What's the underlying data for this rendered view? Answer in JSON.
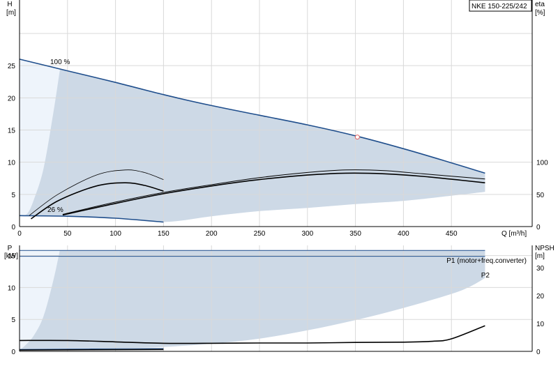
{
  "chart_data": [
    {
      "type": "line",
      "title": "NKE 150-225/242",
      "x_unit_label": "Q [m³/h]",
      "x_range": [
        0,
        500
      ],
      "x_ticks": [
        0,
        50,
        100,
        150,
        200,
        250,
        300,
        350,
        400,
        450
      ],
      "y_left": {
        "label_top": "H",
        "label_unit": "[m]",
        "range": [
          0,
          30
        ],
        "ticks": [
          0,
          5,
          10,
          15,
          20,
          25
        ]
      },
      "y_right": {
        "label_top": "eta",
        "label_unit": "[%]",
        "range": [
          0,
          100
        ],
        "ticks": [
          0,
          50,
          100
        ]
      },
      "grid": true,
      "annotations": [
        "100 %",
        "26 %"
      ],
      "operating_point": {
        "q": 352,
        "h": 13.9
      },
      "series": [
        {
          "role": "head_max",
          "axis": "left",
          "color": "#1f4e8c",
          "x": [
            0,
            50,
            100,
            150,
            200,
            250,
            300,
            350,
            400,
            450,
            485
          ],
          "y": [
            26.0,
            24.2,
            22.4,
            20.5,
            18.8,
            17.3,
            15.8,
            14.1,
            12.1,
            9.9,
            8.3
          ]
        },
        {
          "role": "head_min",
          "axis": "left",
          "color": "#1f4e8c",
          "x": [
            0,
            50,
            100,
            150
          ],
          "y": [
            1.7,
            1.6,
            1.3,
            0.7
          ]
        },
        {
          "role": "eta_p1",
          "axis": "left",
          "color": "#000000",
          "x": [
            45,
            100,
            150,
            200,
            250,
            300,
            340,
            380,
            420,
            460,
            485
          ],
          "y": [
            1.9,
            3.8,
            5.3,
            6.5,
            7.6,
            8.4,
            8.8,
            8.7,
            8.2,
            7.7,
            7.4
          ]
        },
        {
          "role": "eta_p2",
          "axis": "left",
          "color": "#000000",
          "x": [
            45,
            100,
            150,
            200,
            250,
            300,
            340,
            380,
            420,
            460,
            485
          ],
          "y": [
            1.8,
            3.6,
            5.1,
            6.3,
            7.3,
            8.0,
            8.3,
            8.2,
            7.8,
            7.2,
            6.8
          ]
        },
        {
          "role": "eta_low_thin",
          "axis": "left",
          "color": "#000000",
          "x": [
            10,
            40,
            80,
            110,
            130,
            150
          ],
          "y": [
            1.7,
            5.0,
            8.0,
            8.8,
            8.4,
            7.3
          ]
        },
        {
          "role": "eta_low_thick",
          "axis": "left",
          "color": "#000000",
          "x": [
            12,
            40,
            80,
            110,
            130,
            150
          ],
          "y": [
            1.2,
            4.0,
            6.3,
            6.8,
            6.4,
            5.5
          ]
        }
      ],
      "region_outer": {
        "upper_x": [
          0,
          50,
          100,
          150,
          200,
          250,
          300,
          350,
          400,
          450,
          485
        ],
        "upper_y": [
          26.0,
          24.2,
          22.4,
          20.5,
          18.8,
          17.3,
          15.8,
          14.1,
          12.1,
          9.9,
          8.3
        ],
        "lower_x": [
          485,
          450,
          400,
          350,
          300,
          250,
          200,
          150,
          100,
          50,
          0
        ],
        "lower_y": [
          5.4,
          4.8,
          4.0,
          3.5,
          2.9,
          2.4,
          1.6,
          0.7,
          1.3,
          1.6,
          1.7
        ]
      },
      "region_inner_lower": {
        "x": [
          42,
          35,
          25,
          15,
          8,
          0
        ],
        "y": [
          24.3,
          17.5,
          9.0,
          4.2,
          2.0,
          1.7
        ]
      }
    },
    {
      "type": "line",
      "x_range": [
        0,
        500
      ],
      "x_ticks": [
        50,
        100,
        150,
        200,
        250,
        300,
        350,
        400,
        450
      ],
      "y_left": {
        "label_top": "P",
        "label_unit": "[kW]",
        "range": [
          0,
          17.5
        ],
        "ticks": [
          0,
          5,
          10,
          15
        ]
      },
      "y_right": {
        "label_top": "NPSH",
        "label_unit": "[m]",
        "range": [
          0,
          35
        ],
        "ticks": [
          0,
          10,
          20,
          30
        ]
      },
      "grid": true,
      "legend": [
        "P1 (motor+freq.converter)",
        "P2"
      ],
      "series": [
        {
          "name": "P1 (motor+freq.converter)",
          "axis": "left",
          "color": "#1f4e8c",
          "x": [
            0,
            485
          ],
          "y": [
            15.8,
            15.8
          ]
        },
        {
          "name": "P2",
          "axis": "left",
          "color": "#1f4e8c",
          "x": [
            0,
            485
          ],
          "y": [
            14.9,
            14.9
          ]
        },
        {
          "role": "power_min",
          "axis": "left",
          "color": "#1f4e8c",
          "x": [
            0,
            50,
            100,
            150
          ],
          "y": [
            0.3,
            0.35,
            0.4,
            0.45
          ]
        },
        {
          "role": "power_min_dark",
          "axis": "left",
          "color": "#000000",
          "x": [
            0,
            150
          ],
          "y": [
            0.2,
            0.3
          ]
        },
        {
          "role": "npsh",
          "axis": "right",
          "color": "#000000",
          "x": [
            0,
            50,
            100,
            150,
            200,
            250,
            300,
            350,
            400,
            430,
            450,
            485
          ],
          "y": [
            3.9,
            3.9,
            3.4,
            2.9,
            2.9,
            3.0,
            3.0,
            3.2,
            3.3,
            3.6,
            4.5,
            9.2
          ]
        }
      ],
      "region_outer": {
        "upper_x": [
          0,
          485
        ],
        "upper_y": [
          15.8,
          15.8
        ],
        "lower_x": [
          485,
          470,
          450,
          400,
          350,
          300,
          250,
          200,
          150,
          100,
          50,
          0
        ],
        "lower_y": [
          11.5,
          10.2,
          9.0,
          6.8,
          4.9,
          3.3,
          2.0,
          1.2,
          0.7,
          0.5,
          0.4,
          0.3
        ]
      },
      "region_inner_lower": {
        "x": [
          42,
          35,
          25,
          15,
          5,
          0
        ],
        "y": [
          15.8,
          11.0,
          5.5,
          2.5,
          0.8,
          0.3
        ]
      }
    }
  ]
}
